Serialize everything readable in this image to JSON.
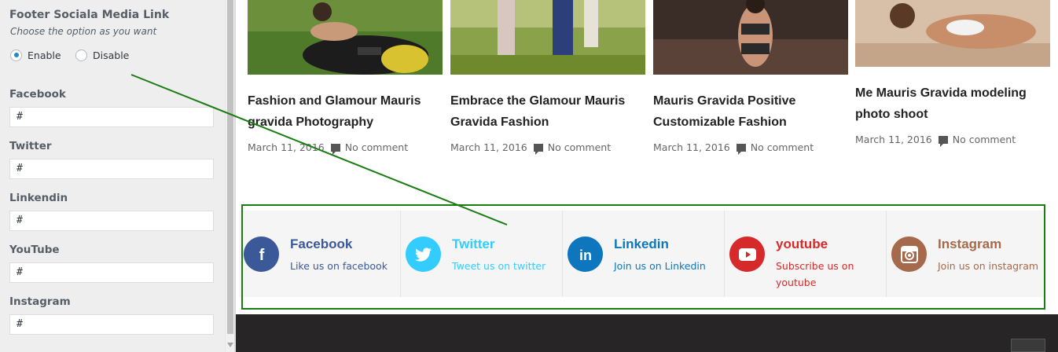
{
  "panel": {
    "title": "Footer Sociala Media Link",
    "description": "Choose the option as you want",
    "options": [
      {
        "label": "Enable",
        "checked": true
      },
      {
        "label": "Disable",
        "checked": false
      }
    ],
    "fields": [
      {
        "label": "Facebook",
        "value": "#"
      },
      {
        "label": "Twitter",
        "value": "#"
      },
      {
        "label": "Linkendin",
        "value": "#"
      },
      {
        "label": "YouTube",
        "value": "#"
      },
      {
        "label": "Instagram",
        "value": "#"
      }
    ]
  },
  "posts": [
    {
      "title": "Fashion and Glamour Mauris gravida Photography",
      "date": "March 11, 2016",
      "comments": "No comment"
    },
    {
      "title": "Embrace the Glamour Mauris Gravida Fashion",
      "date": "March 11, 2016",
      "comments": "No comment"
    },
    {
      "title": "Mauris Gravida Positive Customizable Fashion",
      "date": "March 11, 2016",
      "comments": "No comment"
    },
    {
      "title": "Me Mauris Gravida modeling photo shoot",
      "date": "March 11, 2016",
      "comments": "No comment"
    }
  ],
  "social": [
    {
      "name": "Facebook",
      "sub": "Like us on facebook",
      "icon": "facebook-icon",
      "color": "#3b5998",
      "text_color": "#3b5998",
      "sub_color": "#3b5998"
    },
    {
      "name": "Twitter",
      "sub": "Tweet us on twitter",
      "icon": "twitter-icon",
      "color": "#33ccff",
      "text_color": "#33ccff",
      "sub_color": "#33ccff"
    },
    {
      "name": "Linkedin",
      "sub": "Join us on Linkedin",
      "icon": "linkedin-icon",
      "color": "#0e76bc",
      "text_color": "#0e76bc",
      "sub_color": "#0e76bc"
    },
    {
      "name": "youtube",
      "sub": "Subscribe us on youtube",
      "icon": "youtube-icon",
      "color": "#d62a2a",
      "text_color": "#d62a2a",
      "sub_color": "#d62a2a"
    },
    {
      "name": "Instagram",
      "sub": "Join us on instagram",
      "icon": "instagram-icon",
      "color": "#a56a4c",
      "text_color": "#a56a4c",
      "sub_color": "#a56a4c"
    }
  ],
  "colors": {
    "annotation_green": "#1a7d12",
    "footer_dark": "#272525"
  }
}
